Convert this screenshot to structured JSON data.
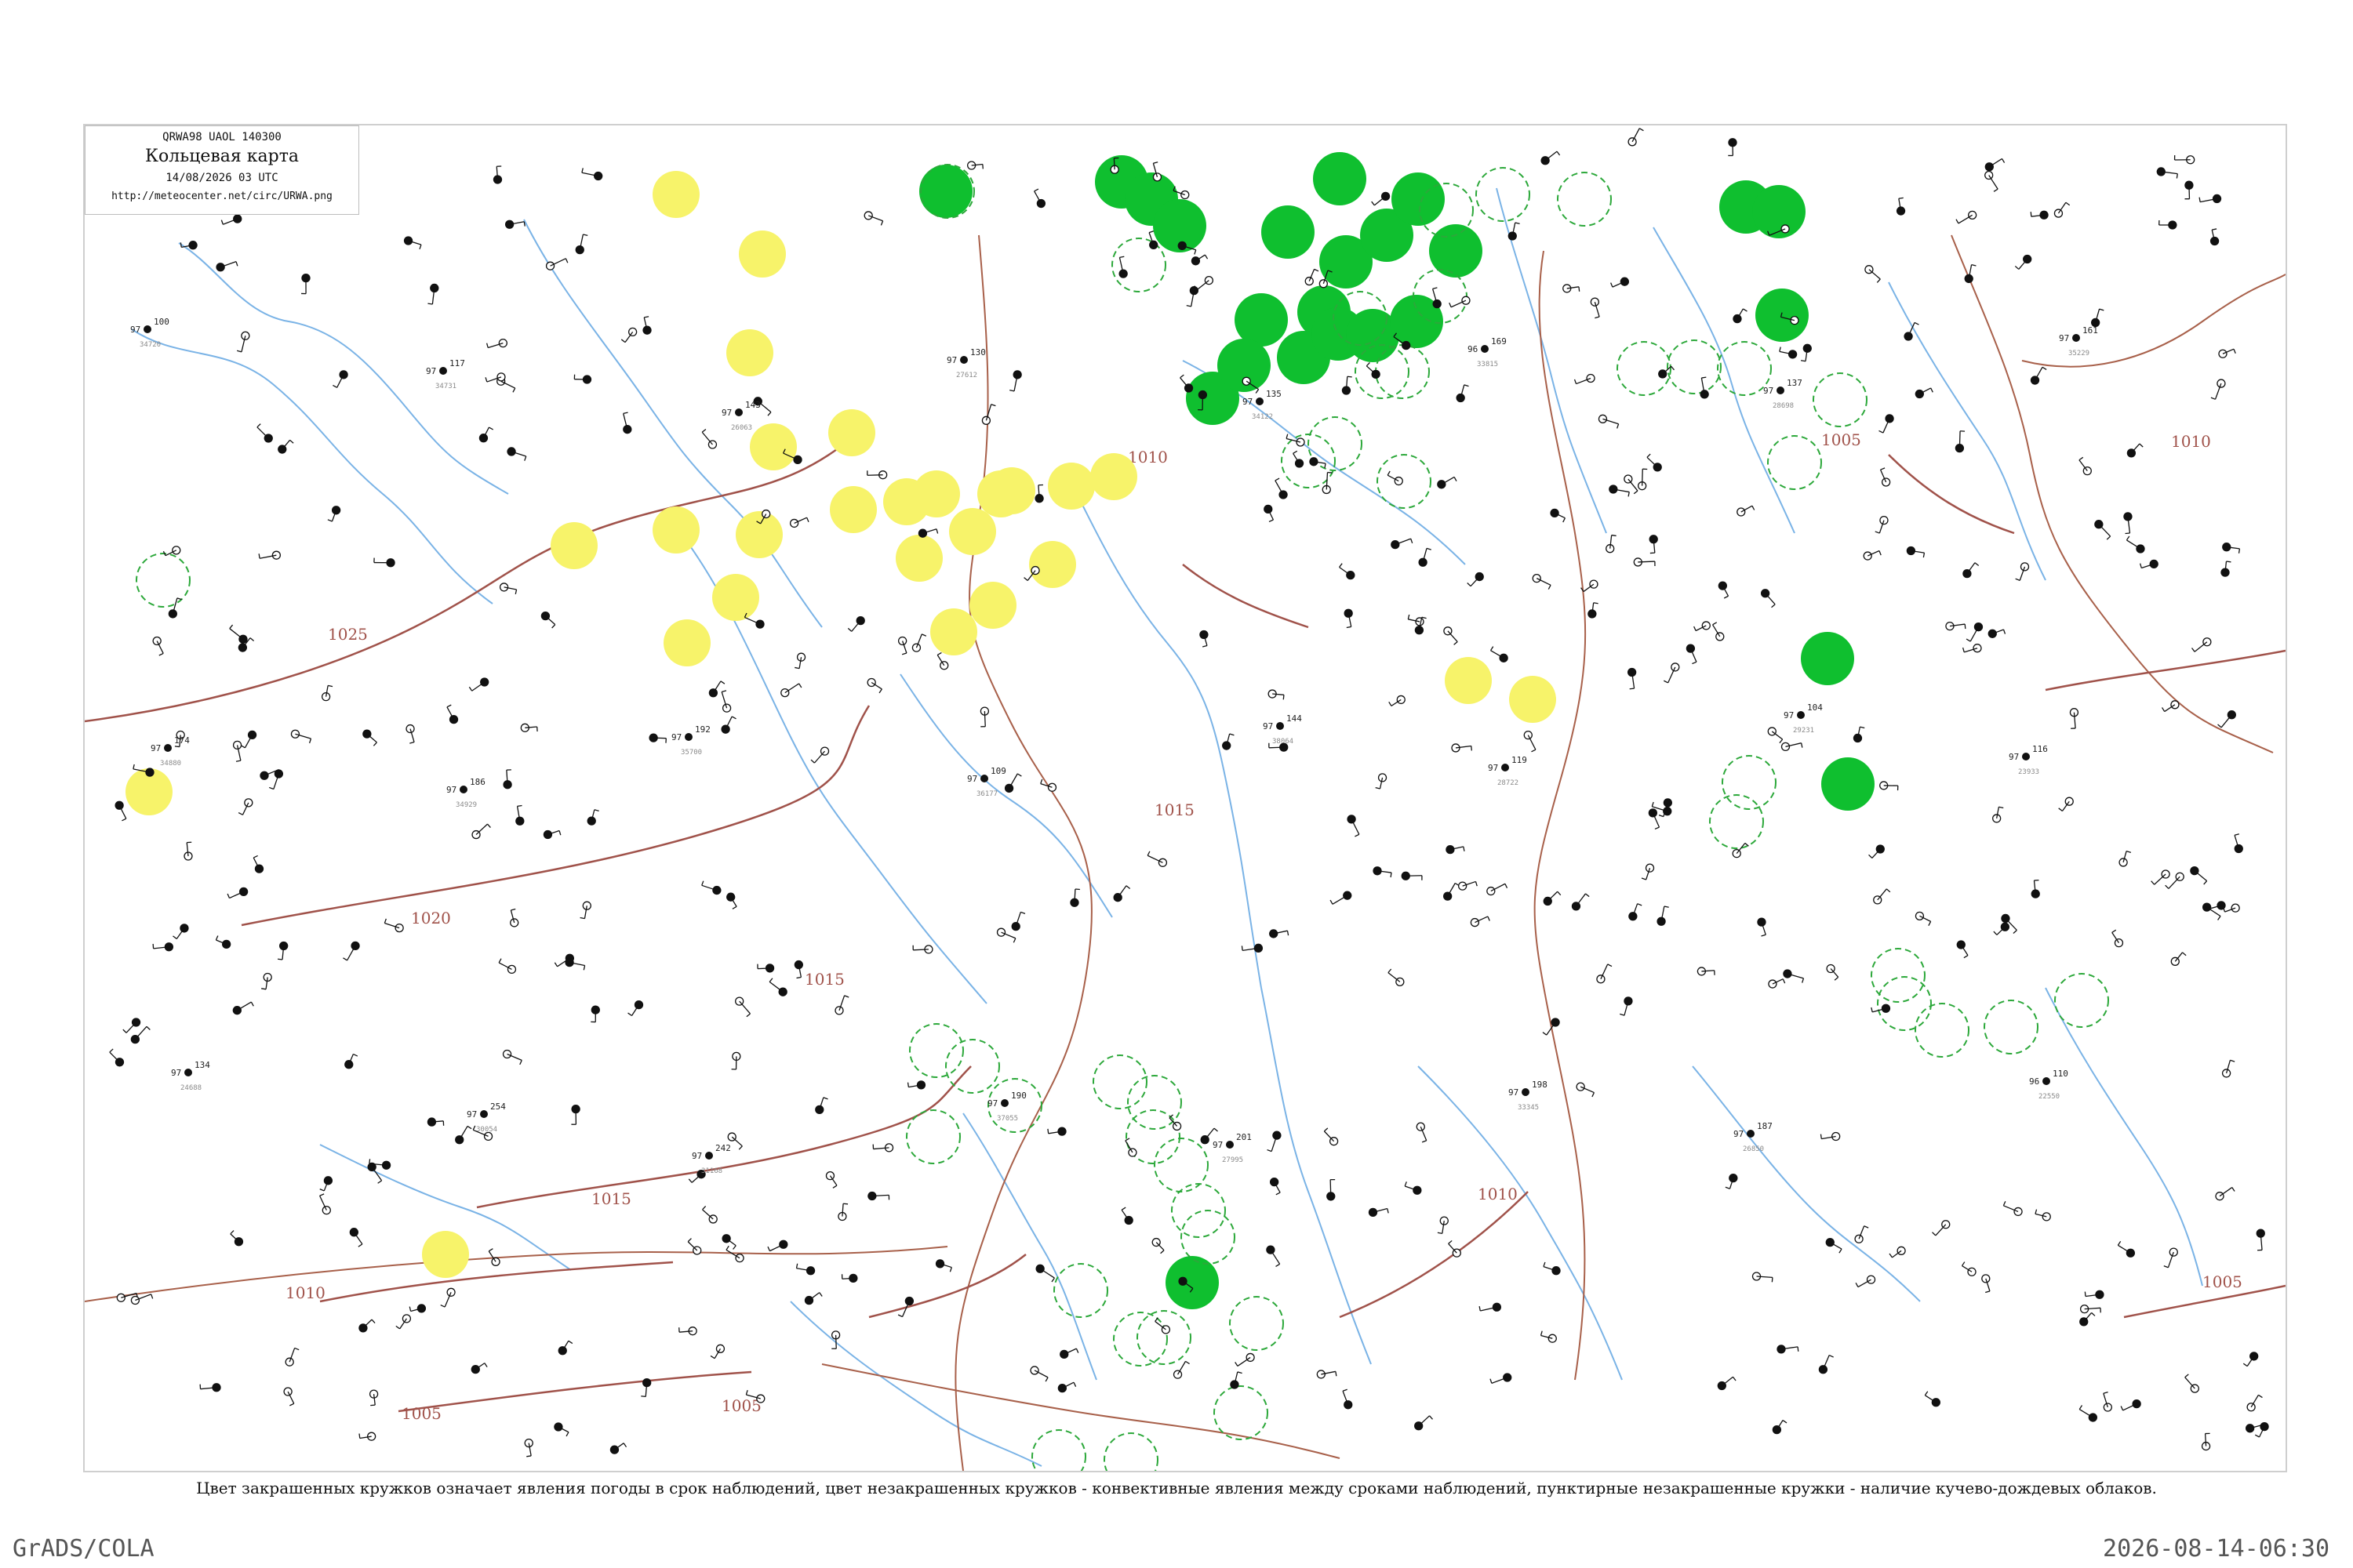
{
  "header": {
    "code": "QRWA98  UAOL  140300",
    "title": "Кольцевая карта",
    "date": "14/08/2026 03 UTC",
    "url": "http://meteocenter.net/circ/URWA.png"
  },
  "isobars": [
    "1025",
    "1020",
    "1015",
    "1015",
    "1015",
    "1010",
    "1010",
    "1010",
    "1005",
    "1005",
    "1005",
    "1005",
    "1010"
  ],
  "legend": {
    "caption": "Цвет закрашенных кружков означает явления погоды в срок наблюдений, цвет незакрашенных кружков - конвективные явления между сроками наблюдений, пунктирные незакрашенные кружки - наличие кучево-дождевых облаков."
  },
  "footer": {
    "left": "GrADS/COLA",
    "right": "2026-08-14-06:30"
  },
  "colors": {
    "river": "#7ab3e6",
    "border": "#a8604a",
    "isobar": "#a0524a",
    "green": "#0fbf2f",
    "yellow": "#f7f36a",
    "circle_outline": "#2ca83a",
    "station_text": "#222222"
  },
  "stations": [
    {
      "n": "34720",
      "p": "100",
      "t": "97"
    },
    {
      "n": "34731",
      "p": "117",
      "t": "97"
    },
    {
      "n": "26063",
      "p": "143",
      "t": "97"
    },
    {
      "n": "27612",
      "p": "130",
      "t": "97"
    },
    {
      "n": "34122",
      "p": "135",
      "t": "97"
    },
    {
      "n": "33815",
      "p": "169",
      "t": "96"
    },
    {
      "n": "28698",
      "p": "137",
      "t": "97"
    },
    {
      "n": "35229",
      "p": "161",
      "t": "97"
    },
    {
      "n": "34880",
      "p": "174",
      "t": "97"
    },
    {
      "n": "34929",
      "p": "186",
      "t": "97"
    },
    {
      "n": "35700",
      "p": "192",
      "t": "97"
    },
    {
      "n": "36177",
      "p": "109",
      "t": "97"
    },
    {
      "n": "38064",
      "p": "144",
      "t": "97"
    },
    {
      "n": "28722",
      "p": "119",
      "t": "97"
    },
    {
      "n": "29231",
      "p": "104",
      "t": "97"
    },
    {
      "n": "23933",
      "p": "116",
      "t": "97"
    },
    {
      "n": "24688",
      "p": "134",
      "t": "97"
    },
    {
      "n": "30054",
      "p": "254",
      "t": "97"
    },
    {
      "n": "31168",
      "p": "242",
      "t": "97"
    },
    {
      "n": "37055",
      "p": "190",
      "t": "97"
    },
    {
      "n": "27995",
      "p": "201",
      "t": "97"
    },
    {
      "n": "33345",
      "p": "198",
      "t": "97"
    },
    {
      "n": "26850",
      "p": "187",
      "t": "97"
    },
    {
      "n": "22550",
      "p": "110",
      "t": "96"
    }
  ]
}
